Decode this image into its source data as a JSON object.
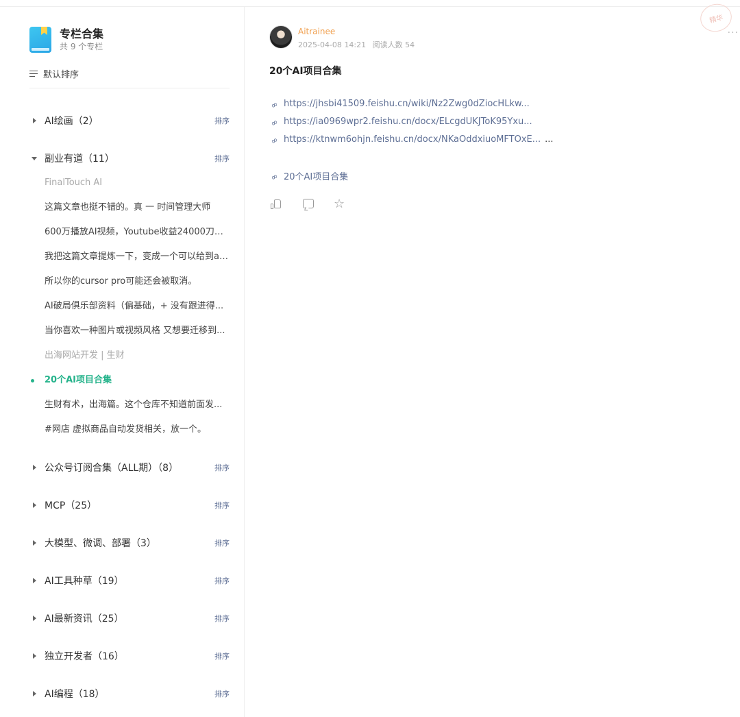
{
  "column": {
    "title": "专栏合集",
    "count": "共 9 个专栏",
    "sort_label": "默认排序"
  },
  "groups": [
    {
      "label": "AI绘画（2）",
      "sort": "排序",
      "expanded": false
    },
    {
      "label": "副业有道（11）",
      "sort": "排序",
      "expanded": true
    },
    {
      "label": "公众号订阅合集（ALL期）（8）",
      "sort": "排序",
      "expanded": false
    },
    {
      "label": "MCP（25）",
      "sort": "排序",
      "expanded": false
    },
    {
      "label": "大模型、微调、部署（3）",
      "sort": "排序",
      "expanded": false
    },
    {
      "label": "AI工具种草（19）",
      "sort": "排序",
      "expanded": false
    },
    {
      "label": "AI最新资讯（25）",
      "sort": "排序",
      "expanded": false
    },
    {
      "label": "独立开发者（16）",
      "sort": "排序",
      "expanded": false
    },
    {
      "label": "AI编程（18）",
      "sort": "排序",
      "expanded": false
    }
  ],
  "articles": [
    {
      "title": "FinalTouch AI",
      "state": "muted"
    },
    {
      "title": "这篇文章也挺不错的。真 一 时间管理大师",
      "state": "normal"
    },
    {
      "title": "600万播放AI视频，Youtube收益24000刀，...",
      "state": "normal"
    },
    {
      "title": "我把这篇文章提炼一下，变成一个可以给到ai...",
      "state": "normal"
    },
    {
      "title": "所以你的cursor pro可能还会被取消。",
      "state": "normal"
    },
    {
      "title": "AI破局俱乐部资料（偏基础，+ 没有跟进得...",
      "state": "normal"
    },
    {
      "title": "当你喜欢一种图片或视频风格 又想要迁移到...",
      "state": "normal"
    },
    {
      "title": "出海网站开发 | 生财",
      "state": "muted"
    },
    {
      "title": "20个AI项目合集",
      "state": "active"
    },
    {
      "title": "生财有术，出海篇。这个仓库不知道前面发...",
      "state": "normal"
    },
    {
      "title": "#网店 虚拟商品自动发货相关，放一个。",
      "state": "normal"
    }
  ],
  "post": {
    "author": "Aitrainee",
    "date": "2025-04-08 14:21",
    "reads": "阅读人数 54",
    "title": "20个AI项目合集",
    "links": [
      {
        "text": "https://jhsbi41509.feishu.cn/wiki/Nz2Zwg0dZiocHLkw..."
      },
      {
        "text": "https://ia0969wpr2.feishu.cn/docx/ELcgdUKJToK95Yxu..."
      },
      {
        "text": "https://ktnwm6ohjn.feishu.cn/docx/NKaOddxiuoMFTOxE...",
        "more": "..."
      }
    ],
    "collection_link": "20个AI项目合集"
  },
  "stamp_text": "精华",
  "more_text": "···",
  "colors": {
    "accent": "#25b38b",
    "link": "#5d6e94",
    "author": "#f0a050"
  }
}
